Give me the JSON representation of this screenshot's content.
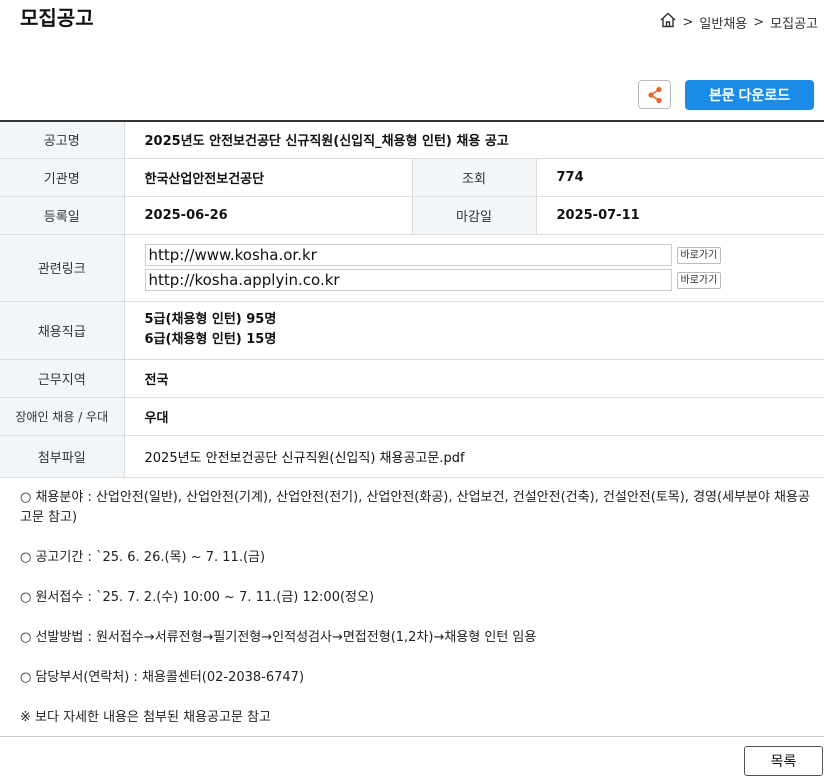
{
  "page": {
    "title": "모집공고",
    "breadcrumb": [
      ">",
      "일반채용",
      ">",
      "모집공고"
    ]
  },
  "actions": {
    "download_label": "본문 다운로드",
    "list_label": "목록"
  },
  "info": {
    "title_label": "공고명",
    "title_value": "2025년도 안전보건공단 신규직원(신입직_채용형 인턴) 채용 공고",
    "org_label": "기관명",
    "org_value": "한국산업안전보건공단",
    "views_label": "조회",
    "views_value": "774",
    "reg_label": "등록일",
    "reg_value": "2025-06-26",
    "deadline_label": "마감일",
    "deadline_value": "2025-07-11",
    "links_label": "관련링크",
    "links": [
      {
        "url": "http://www.kosha.or.kr",
        "button": "바로가기"
      },
      {
        "url": "http://kosha.applyin.co.kr",
        "button": "바로가기"
      }
    ],
    "grade_label": "채용직급",
    "grade_lines": [
      "5급(채용형 인턴) 95명",
      "6급(채용형 인턴) 15명"
    ],
    "region_label": "근무지역",
    "region_value": "전국",
    "disability_label": "장애인 채용 / 우대",
    "disability_value": "우대",
    "attach_label": "첨부파일",
    "attach_value": "2025년도 안전보건공단 신규직원(신입직) 채용공고문.pdf"
  },
  "content": [
    "○ 채용분야 : 산업안전(일반), 산업안전(기계), 산업안전(전기), 산업안전(화공), 산업보건, 건설안전(건축), 건설안전(토목), 경영(세부분야 채용공고문 참고)",
    "○ 공고기간 : `25. 6. 26.(목) ~ 7. 11.(금)",
    "○ 원서접수 : `25. 7. 2.(수) 10:00 ~ 7. 11.(금) 12:00(정오)",
    "○ 선발방법 : 원서접수→서류전형→필기전형→인적성검사→면접전형(1,2차)→채용형 인턴 임용",
    "○ 담당부서(연락처) : 채용콜센터(02-2038-6747)",
    "※ 보다 자세한 내용은 첨부된 채용공고문 참고"
  ],
  "colors": {
    "accent": "#1a8be6",
    "share": "#e8632b"
  },
  "icons": [
    "home-icon",
    "share-icon"
  ]
}
